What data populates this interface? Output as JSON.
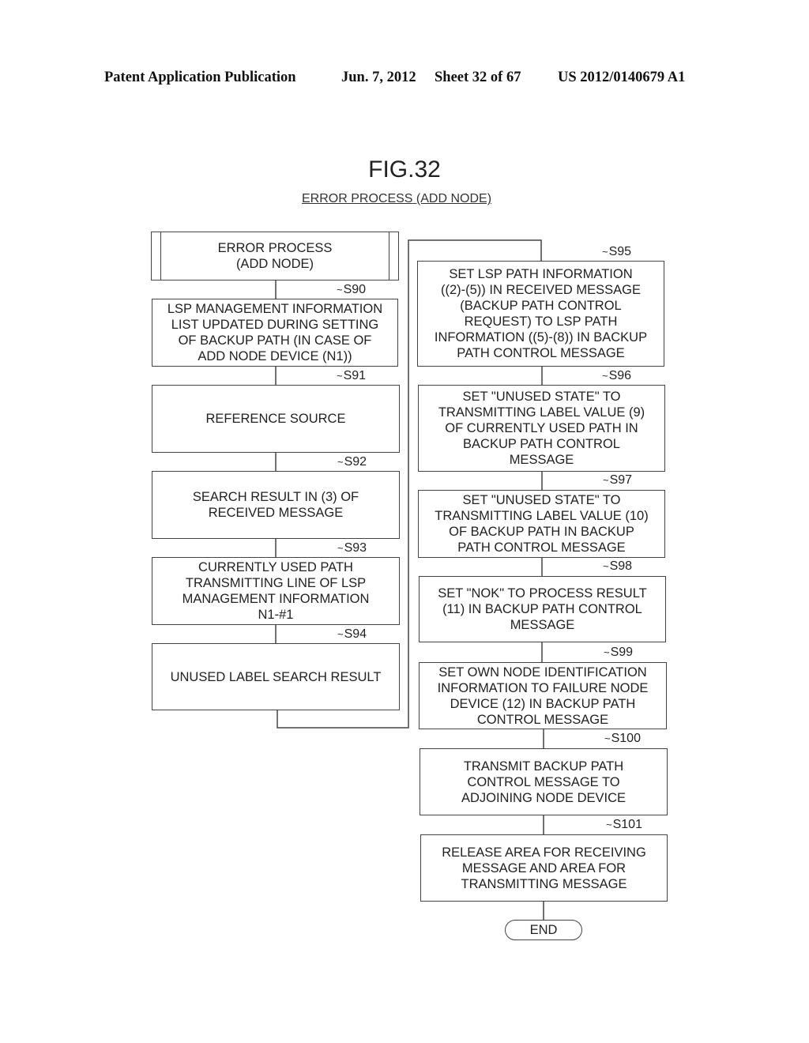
{
  "header": {
    "publication": "Patent Application Publication",
    "date": "Jun. 7, 2012",
    "sheet": "Sheet 32 of 67",
    "number": "US 2012/0140679 A1"
  },
  "figure": {
    "title": "FIG.32",
    "subtitle": "ERROR PROCESS (ADD NODE)"
  },
  "flow": {
    "start": "ERROR PROCESS\n(ADD NODE)",
    "steps": [
      {
        "id": "S90",
        "text": "LSP MANAGEMENT INFORMATION\nLIST UPDATED DURING SETTING\nOF BACKUP PATH (IN CASE OF\nADD NODE DEVICE (N1))"
      },
      {
        "id": "S91",
        "text": "REFERENCE SOURCE"
      },
      {
        "id": "S92",
        "text": "SEARCH RESULT IN (3) OF\nRECEIVED MESSAGE"
      },
      {
        "id": "S93",
        "text": "CURRENTLY USED PATH\nTRANSMITTING LINE OF LSP\nMANAGEMENT INFORMATION\nN1-#1"
      },
      {
        "id": "S94",
        "text": "UNUSED LABEL SEARCH RESULT"
      },
      {
        "id": "S95",
        "text": "SET LSP PATH INFORMATION\n((2)-(5)) IN RECEIVED MESSAGE\n(BACKUP PATH CONTROL\nREQUEST) TO LSP PATH\nINFORMATION ((5)-(8)) IN BACKUP\nPATH CONTROL MESSAGE"
      },
      {
        "id": "S96",
        "text": "SET \"UNUSED STATE\" TO\nTRANSMITTING LABEL VALUE (9)\nOF CURRENTLY USED PATH IN\nBACKUP PATH CONTROL\nMESSAGE"
      },
      {
        "id": "S97",
        "text": "SET \"UNUSED STATE\" TO\nTRANSMITTING LABEL VALUE (10)\nOF BACKUP PATH IN BACKUP\nPATH CONTROL MESSAGE"
      },
      {
        "id": "S98",
        "text": "SET \"NOK\" TO PROCESS RESULT\n(11) IN BACKUP PATH CONTROL\nMESSAGE"
      },
      {
        "id": "S99",
        "text": "SET OWN NODE IDENTIFICATION\nINFORMATION TO FAILURE NODE\nDEVICE (12) IN BACKUP PATH\nCONTROL MESSAGE"
      },
      {
        "id": "S100",
        "text": "TRANSMIT BACKUP PATH\nCONTROL MESSAGE TO\nADJOINING NODE DEVICE"
      },
      {
        "id": "S101",
        "text": "RELEASE AREA FOR RECEIVING\nMESSAGE AND AREA FOR\nTRANSMITTING MESSAGE"
      }
    ],
    "end": "END"
  }
}
